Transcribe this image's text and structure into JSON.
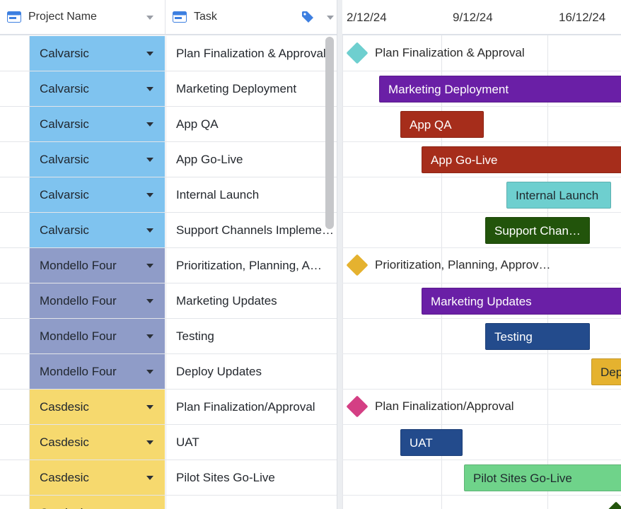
{
  "header": {
    "project_col": "Project Name",
    "task_col": "Task",
    "dates": [
      "2/12/24",
      "9/12/24",
      "16/12/24"
    ]
  },
  "colors": {
    "Calvarsic": "#7fc3ef",
    "Mondello Four": "#8f9cc8",
    "Casdesic": "#f6d96e",
    "purple": "#6a1fa6",
    "red": "#a62d1b",
    "teal": "#6ecfcf",
    "darkgreen": "#22540b",
    "navy": "#234b8c",
    "gold": "#e5b22f",
    "green": "#6fd38a",
    "pink": "#d43f84"
  },
  "rows": [
    {
      "project": "Calvarsic",
      "task": "Plan Finalization & Approval"
    },
    {
      "project": "Calvarsic",
      "task": "Marketing Deployment"
    },
    {
      "project": "Calvarsic",
      "task": "App QA"
    },
    {
      "project": "Calvarsic",
      "task": "App Go-Live"
    },
    {
      "project": "Calvarsic",
      "task": "Internal Launch"
    },
    {
      "project": "Calvarsic",
      "task": "Support Channels Impleme…"
    },
    {
      "project": "Mondello Four",
      "task": "Prioritization, Planning,  A…"
    },
    {
      "project": "Mondello Four",
      "task": "Marketing Updates"
    },
    {
      "project": "Mondello Four",
      "task": "Testing"
    },
    {
      "project": "Mondello Four",
      "task": "Deploy Updates"
    },
    {
      "project": "Casdesic",
      "task": "Plan Finalization/Approval"
    },
    {
      "project": "Casdesic",
      "task": "UAT"
    },
    {
      "project": "Casdesic",
      "task": "Pilot Sites Go-Live"
    },
    {
      "project": "Casdesic",
      "task": ""
    }
  ],
  "gantt": [
    {
      "kind": "milestone",
      "label": "Plan Finalization & Approval",
      "color": "teal"
    },
    {
      "kind": "bar",
      "label": "Marketing Deployment",
      "color": "purple"
    },
    {
      "kind": "bar",
      "label": "App QA",
      "color": "red"
    },
    {
      "kind": "bar",
      "label": "App Go-Live",
      "color": "red"
    },
    {
      "kind": "bar",
      "label": "Internal Launch",
      "color": "teal"
    },
    {
      "kind": "bar",
      "label": "Support Chan…",
      "color": "darkgreen"
    },
    {
      "kind": "milestone",
      "label": "Prioritization, Planning, Approv…",
      "color": "gold"
    },
    {
      "kind": "bar",
      "label": "Marketing Updates",
      "color": "purple"
    },
    {
      "kind": "bar",
      "label": "Testing",
      "color": "navy"
    },
    {
      "kind": "bar",
      "label": "Dep",
      "color": "gold"
    },
    {
      "kind": "milestone",
      "label": "Plan Finalization/Approval",
      "color": "pink"
    },
    {
      "kind": "bar",
      "label": "UAT",
      "color": "navy"
    },
    {
      "kind": "bar",
      "label": "Pilot Sites Go-Live",
      "color": "green"
    },
    {
      "kind": "milestone",
      "label": "",
      "color": "darkgreen"
    }
  ]
}
